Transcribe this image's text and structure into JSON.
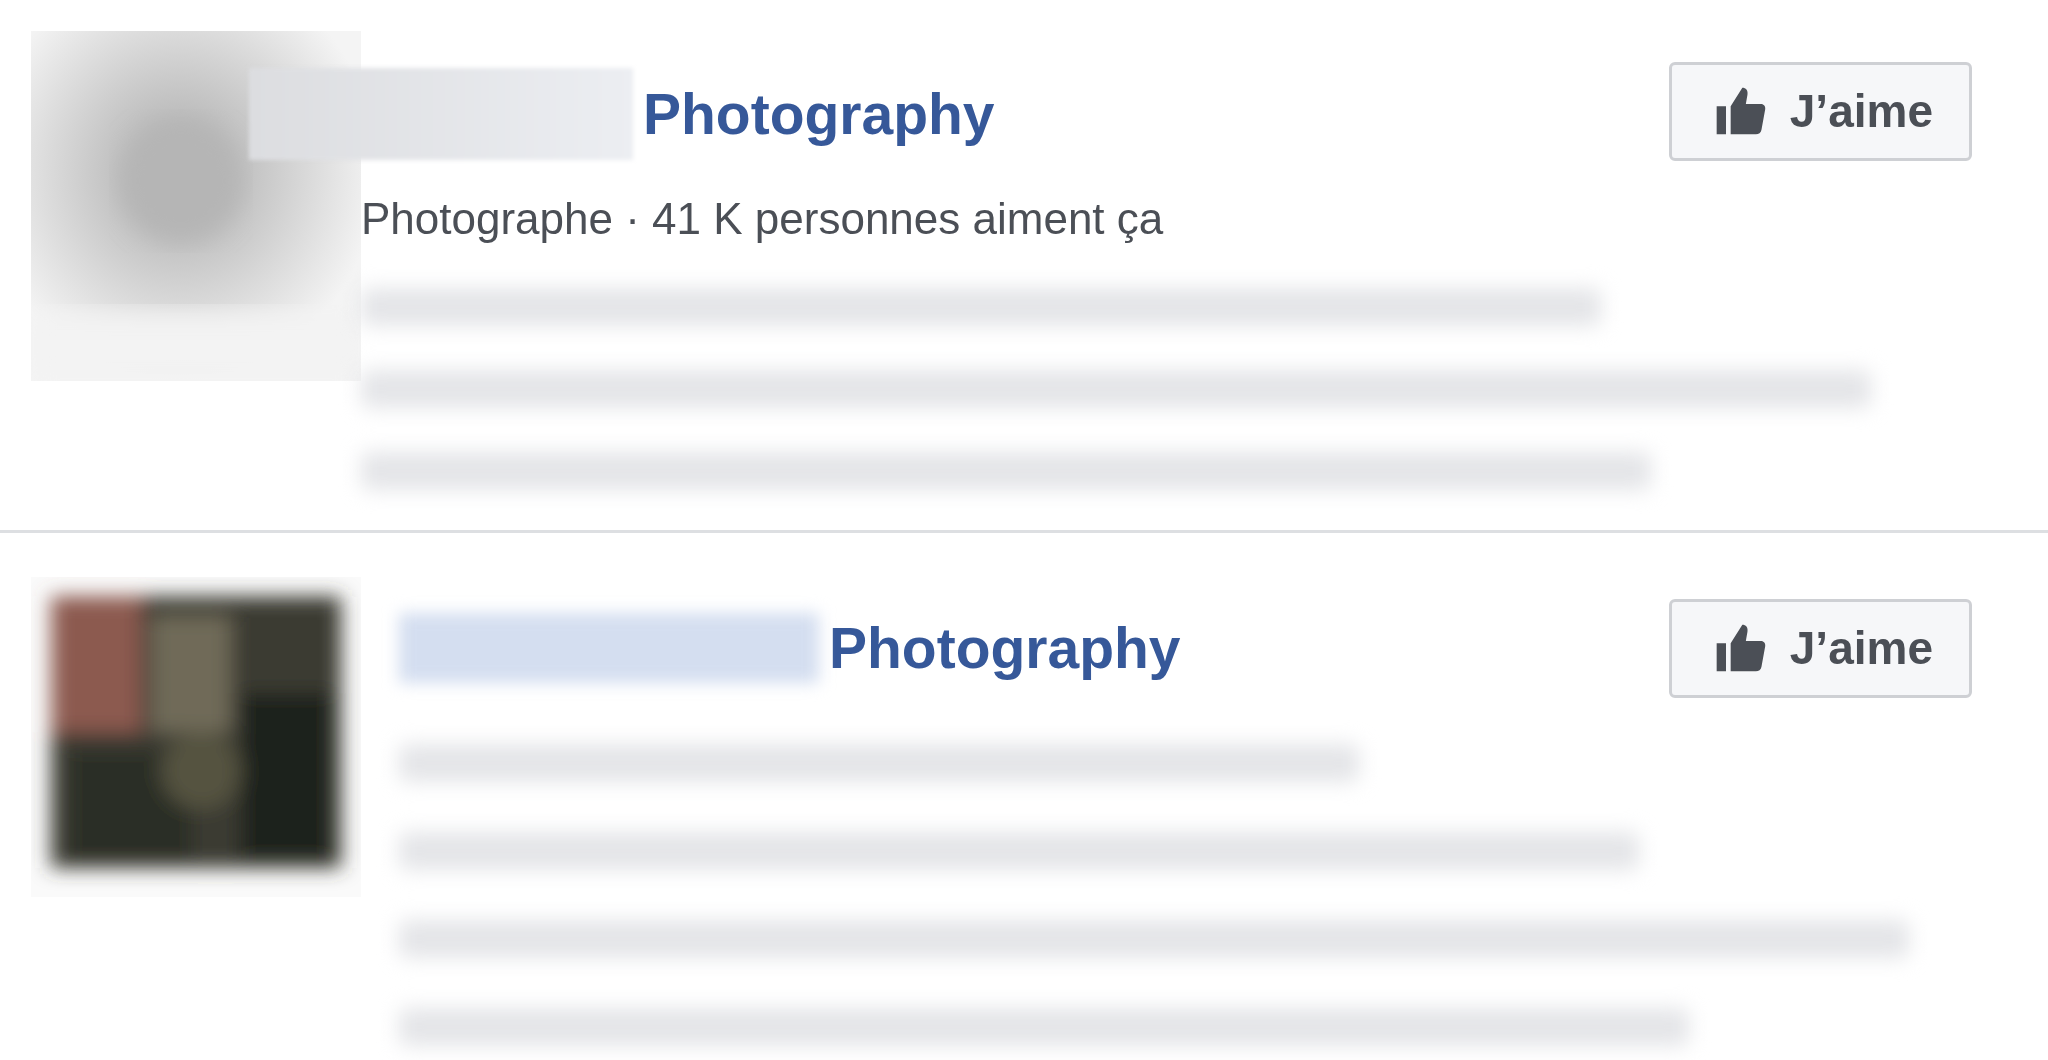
{
  "results": [
    {
      "title": "Photography",
      "subtitle": "Photographe · 41 K personnes aiment ça",
      "like_button": "J’aime"
    },
    {
      "title": "Photography",
      "like_button": "J’aime"
    }
  ]
}
